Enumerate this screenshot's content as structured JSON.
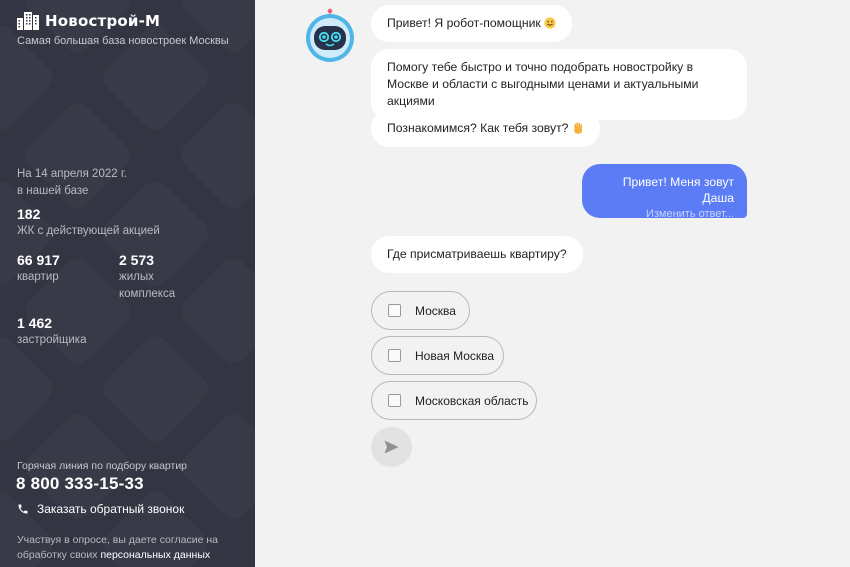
{
  "sidebar": {
    "brand_name": "Новострой-М",
    "brand_subtitle": "Самая большая база новостроек Москвы",
    "stats_date_line1": "На 14 апреля 2022 г.",
    "stats_date_line2": "в нашей базе",
    "stats": [
      {
        "number": "182",
        "label": "ЖК с действующей акцией"
      },
      {
        "number": "66 917",
        "label": "квартир"
      },
      {
        "number": "2 573",
        "label_line1": "жилых",
        "label_line2": "комплекса"
      },
      {
        "number": "1 462",
        "label": "застройщика"
      }
    ],
    "hotline_label": "Горячая линия по подбору квартир",
    "hotline_phone": "8 800 333-15-33",
    "callback_label": "Заказать обратный звонок",
    "consent_text": "Участвуя в опросе, вы даете согласие на обработку своих",
    "consent_link": "персональных данных"
  },
  "chat": {
    "bot_messages": [
      "Привет! Я робот-помощник",
      "Помогу тебе быстро и точно подобрать новостройку в Москве и области с выгодными ценами и актуальными акциями",
      "Познакомимся? Как тебя зовут?"
    ],
    "user_message": "Привет! Меня зовут Даша",
    "user_edit_label": "Изменить ответ...",
    "question": "Где присматриваешь квартиру?",
    "options": [
      "Москва",
      "Новая Москва",
      "Московская область"
    ]
  },
  "colors": {
    "sidebar_bg": "#333542",
    "user_bubble": "#5b7cf5",
    "chat_bg": "#f2f2f2"
  },
  "icons": [
    "building-icon",
    "robot-avatar",
    "smile-emoji",
    "raised-hand-emoji",
    "phone-icon",
    "send-icon"
  ]
}
